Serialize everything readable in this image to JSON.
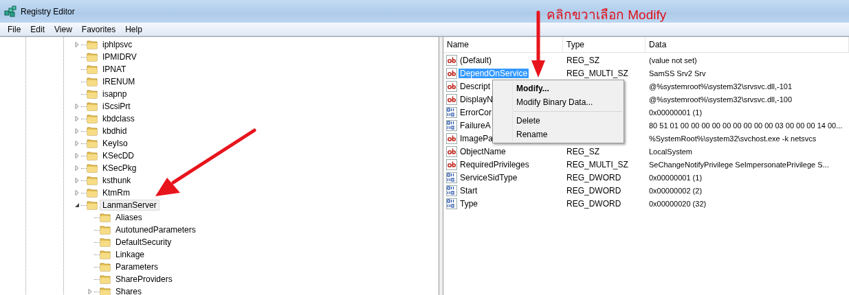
{
  "window": {
    "title": "Registry Editor"
  },
  "annotation": {
    "text": "คลิกขวาเลือก Modify"
  },
  "menu_bar": [
    "File",
    "Edit",
    "View",
    "Favorites",
    "Help"
  ],
  "tree": {
    "items": [
      {
        "label": "iphlpsvc",
        "has_children": true,
        "expanded": false,
        "selected": false
      },
      {
        "label": "IPMIDRV",
        "has_children": false,
        "expanded": false,
        "selected": false
      },
      {
        "label": "IPNAT",
        "has_children": false,
        "expanded": false,
        "selected": false
      },
      {
        "label": "IRENUM",
        "has_children": false,
        "expanded": false,
        "selected": false
      },
      {
        "label": "isapnp",
        "has_children": false,
        "expanded": false,
        "selected": false
      },
      {
        "label": "iScsiPrt",
        "has_children": true,
        "expanded": false,
        "selected": false
      },
      {
        "label": "kbdclass",
        "has_children": true,
        "expanded": false,
        "selected": false
      },
      {
        "label": "kbdhid",
        "has_children": true,
        "expanded": false,
        "selected": false
      },
      {
        "label": "KeyIso",
        "has_children": true,
        "expanded": false,
        "selected": false
      },
      {
        "label": "KSecDD",
        "has_children": true,
        "expanded": false,
        "selected": false
      },
      {
        "label": "KSecPkg",
        "has_children": true,
        "expanded": false,
        "selected": false
      },
      {
        "label": "ksthunk",
        "has_children": true,
        "expanded": false,
        "selected": false
      },
      {
        "label": "KtmRm",
        "has_children": true,
        "expanded": false,
        "selected": false
      },
      {
        "label": "LanmanServer",
        "has_children": true,
        "expanded": true,
        "selected": true,
        "children": [
          {
            "label": "Aliases",
            "has_children": false,
            "expanded": false,
            "selected": false
          },
          {
            "label": "AutotunedParameters",
            "has_children": false,
            "expanded": false,
            "selected": false
          },
          {
            "label": "DefaultSecurity",
            "has_children": false,
            "expanded": false,
            "selected": false
          },
          {
            "label": "Linkage",
            "has_children": false,
            "expanded": false,
            "selected": false
          },
          {
            "label": "Parameters",
            "has_children": false,
            "expanded": false,
            "selected": false
          },
          {
            "label": "ShareProviders",
            "has_children": false,
            "expanded": false,
            "selected": false
          },
          {
            "label": "Shares",
            "has_children": true,
            "expanded": false,
            "selected": false
          }
        ]
      }
    ]
  },
  "values": {
    "columns": [
      "Name",
      "Type",
      "Data"
    ],
    "rows": [
      {
        "kind": "string",
        "name": "(Default)",
        "type": "REG_SZ",
        "data": "(value not set)",
        "selected": false
      },
      {
        "kind": "string",
        "name": "DependOnService",
        "type": "REG_MULTI_SZ",
        "data": "SamSS Srv2 Srv",
        "selected": true
      },
      {
        "kind": "string",
        "name": "Descript",
        "data": "@%systemroot%\\system32\\srvsvc.dll,-101",
        "selected": false
      },
      {
        "kind": "string",
        "name": "DisplayN",
        "data": "@%systemroot%\\system32\\srvsvc.dll,-100",
        "selected": false
      },
      {
        "kind": "binary",
        "name": "ErrorCor",
        "data": "0x00000001 (1)",
        "selected": false
      },
      {
        "kind": "binary",
        "name": "FailureA",
        "data": "80 51 01 00 00 00 00 00 00 00 00 00 03 00 00 00 14 00...",
        "selected": false
      },
      {
        "kind": "string",
        "name": "ImagePa",
        "data": "%SystemRoot%\\system32\\svchost.exe -k netsvcs",
        "selected": false
      },
      {
        "kind": "string",
        "name": "ObjectName",
        "type": "REG_SZ",
        "data": "LocalSystem",
        "selected": false
      },
      {
        "kind": "string",
        "name": "RequiredPrivileges",
        "type": "REG_MULTI_SZ",
        "data": "SeChangeNotifyPrivilege SeImpersonatePrivilege S...",
        "selected": false
      },
      {
        "kind": "binary",
        "name": "ServiceSidType",
        "type": "REG_DWORD",
        "data": "0x00000001 (1)",
        "selected": false
      },
      {
        "kind": "binary",
        "name": "Start",
        "type": "REG_DWORD",
        "data": "0x00000002 (2)",
        "selected": false
      },
      {
        "kind": "binary",
        "name": "Type",
        "type": "REG_DWORD",
        "data": "0x00000020 (32)",
        "selected": false
      }
    ]
  },
  "context_menu": {
    "items": [
      {
        "kind": "item",
        "label": "Modify...",
        "default": true
      },
      {
        "kind": "item",
        "label": "Modify Binary Data...",
        "default": false
      },
      {
        "kind": "separator"
      },
      {
        "kind": "item",
        "label": "Delete",
        "default": false
      },
      {
        "kind": "item",
        "label": "Rename",
        "default": false
      }
    ]
  }
}
